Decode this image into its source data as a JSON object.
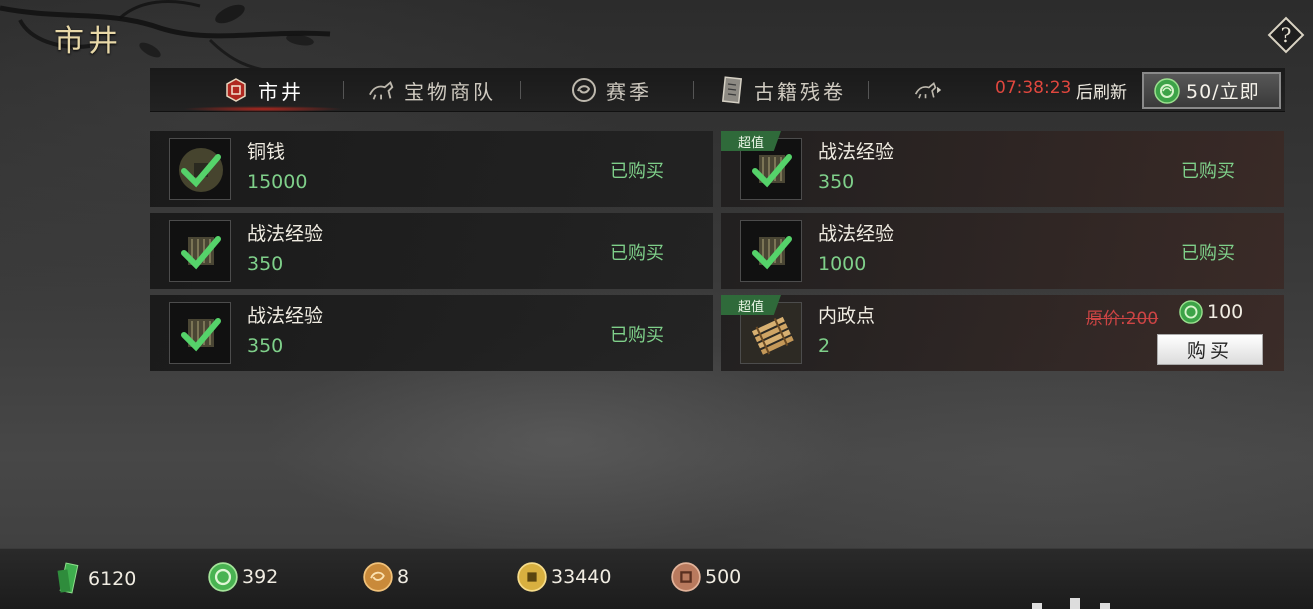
{
  "page": {
    "title": "市井",
    "help_label": "?"
  },
  "tabs": [
    {
      "label": "市井",
      "icon": "market-seal-icon",
      "active": true
    },
    {
      "label": "宝物商队",
      "icon": "caravan-horse-icon",
      "active": false
    },
    {
      "label": "赛季",
      "icon": "season-emblem-icon",
      "active": false
    },
    {
      "label": "古籍残卷",
      "icon": "scroll-book-icon",
      "active": false
    },
    {
      "label": "",
      "icon": "horse-more-icon",
      "active": false
    }
  ],
  "refresh": {
    "timer": "07:38:23",
    "label": "后刷新",
    "cost": "50/立即",
    "currency_icon": "jade-coin-icon"
  },
  "items": [
    {
      "name": "铜钱",
      "qty": "15000",
      "status": "已购买",
      "badge": "",
      "icon": "copper-coin-icon"
    },
    {
      "name": "战法经验",
      "qty": "350",
      "status": "已购买",
      "badge": "超值",
      "icon": "tactic-exp-icon"
    },
    {
      "name": "战法经验",
      "qty": "350",
      "status": "已购买",
      "badge": "",
      "icon": "tactic-exp-icon"
    },
    {
      "name": "战法经验",
      "qty": "1000",
      "status": "已购买",
      "badge": "",
      "icon": "tactic-exp-icon"
    },
    {
      "name": "战法经验",
      "qty": "350",
      "status": "已购买",
      "badge": "",
      "icon": "tactic-exp-icon"
    },
    {
      "name": "内政点",
      "qty": "2",
      "status": "",
      "badge": "超值",
      "icon": "bamboo-slips-icon",
      "original_price": "原价:200",
      "price": "100",
      "buy_label": "购买"
    }
  ],
  "currencies": [
    {
      "icon": "jade-tablet-icon",
      "value": "6120",
      "color": "#3fae4e"
    },
    {
      "icon": "jade-coin-icon",
      "value": "392",
      "color": "#49b352"
    },
    {
      "icon": "bronze-medal-icon",
      "value": "8",
      "color": "#c98a3a"
    },
    {
      "icon": "gold-coin-icon",
      "value": "33440",
      "color": "#d8b040"
    },
    {
      "icon": "copper-coin-icon",
      "value": "500",
      "color": "#b97a5e"
    }
  ]
}
